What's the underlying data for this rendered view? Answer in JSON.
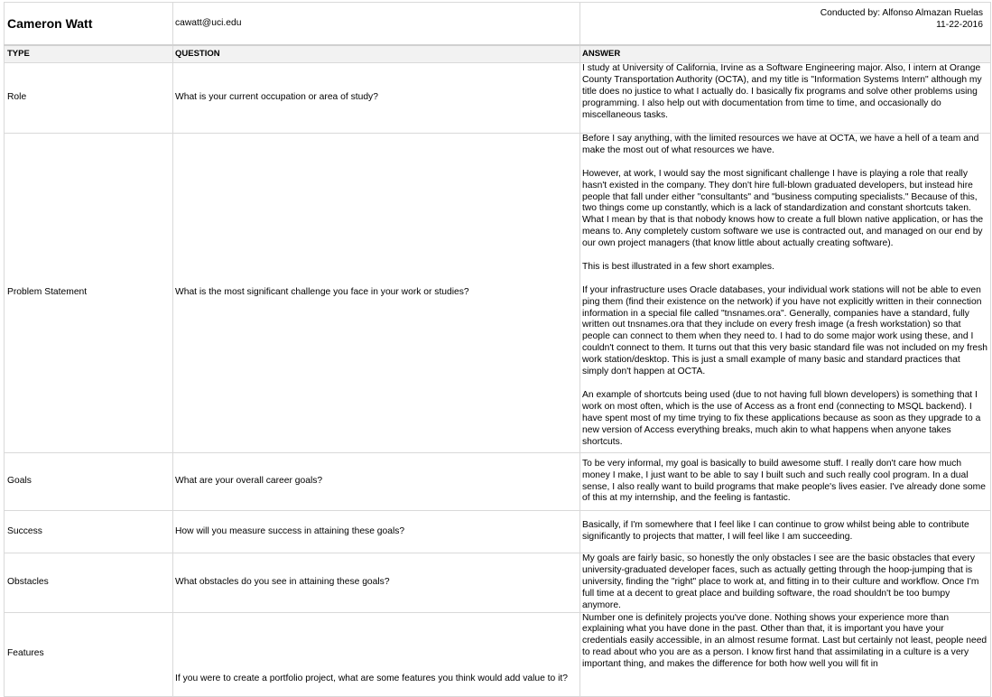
{
  "header": {
    "name": "Cameron Watt",
    "email": "cawatt@uci.edu",
    "conducted_by": "Conducted by: Alfonso Almazan Ruelas",
    "date": "11-22-2016"
  },
  "columns": {
    "type": "TYPE",
    "question": "QUESTION",
    "answer": "ANSWER"
  },
  "rows": [
    {
      "type": "Role",
      "question": "What is your current occupation or area of study?",
      "answer": [
        "I study at University of California, Irvine as a Software Engineering major. Also, I intern at Orange County Transportation Authority (OCTA), and my title is \"Information Systems Intern\" although my title does no justice to what I actually do. I basically fix programs and solve other problems using programming. I also help out with documentation from time to time, and occasionally do miscellaneous tasks."
      ]
    },
    {
      "type": "Problem Statement",
      "question": "What is the most significant challenge you face in your work or studies?",
      "answer": [
        "Before I say anything, with the limited resources we have at OCTA, we have a hell of a team and make the most out of what resources we have.",
        "However, at work, I would say the most significant challenge I have is playing a role that really hasn't existed in the company. They don't hire full-blown graduated developers, but instead hire people that fall under either \"consultants\" and \"business computing specialists.\" Because of this, two things come up constantly, which is a lack of standardization and constant shortcuts taken.  What I mean by that is that nobody knows how to create a full blown native application, or has the means to.  Any completely custom software we use is contracted out, and managed on our end by our own project managers (that know little about actually creating software).",
        "This is best illustrated in a few short examples.",
        "If your infrastructure uses Oracle databases, your individual work stations will not be able to even ping them (find their existence on the network) if you have not explicitly written in their connection information in a special file called \"tnsnames.ora\".  Generally, companies have a standard, fully written out tnsnames.ora that they include on every fresh image (a fresh workstation) so that people can connect to them when they need to.  I had to do some major work using these, and I couldn't connect to them.  It turns out that this very basic standard file was not included on my fresh work station/desktop. This is just a small example of many basic and standard practices that simply don't happen at OCTA.",
        "An example of shortcuts being used (due to not having full blown developers) is something that I work on most often, which is the use of Access as a front end (connecting to MSQL backend).  I have spent most of my time trying to fix these applications because as soon as they upgrade to a new version of Access everything breaks, much akin to what happens when anyone takes shortcuts."
      ]
    },
    {
      "type": "Goals",
      "question": "What are your overall career goals?",
      "answer": [
        "To be very informal, my goal is basically to build awesome stuff. I really don't care how much money I make, I just want to be able to say I built such and such really cool program. In a dual sense, I also really want to build programs that make people's lives easier.  I've already done some of this at my internship, and the feeling is fantastic."
      ]
    },
    {
      "type": "Success",
      "question": "How will you measure success in attaining these goals?",
      "answer": [
        "Basically, if I'm somewhere that I feel like I can continue to grow whilst being able to contribute significantly to projects that matter, I will feel like I am succeeding."
      ]
    },
    {
      "type": "Obstacles",
      "question": "What obstacles do you see in attaining these goals?",
      "answer": [
        "My goals are fairly basic, so honestly the only obstacles I see are the basic obstacles that every university-graduated developer faces, such as actually getting through the hoop-jumping that is university, finding the \"right\" place to work at, and fitting in to their culture and workflow. Once I'm full time at a decent to great place and building software, the road shouldn't be too bumpy anymore."
      ]
    },
    {
      "type": "Features",
      "question": "If you were to create a portfolio project, what are some features you think would add value to it?",
      "answer": [
        "Number one is definitely projects you've done. Nothing shows your experience more than explaining what you have done in the past. Other than that, it is important you have your credentials easily accessible, in an almost resume format.  Last but certainly not least, people need to read about who you are as a person.  I know first hand that assimilating in a culture is a very important thing, and makes the difference for both how well you will fit in"
      ]
    }
  ]
}
